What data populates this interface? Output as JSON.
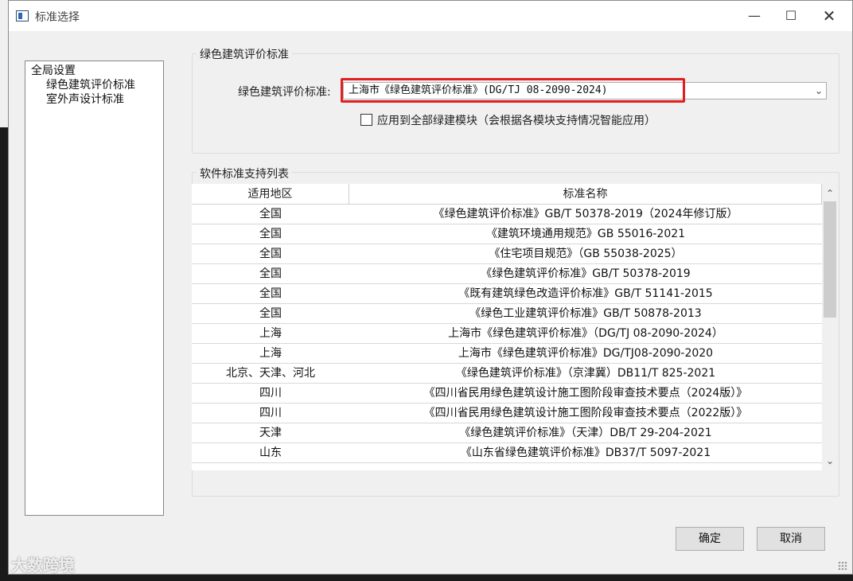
{
  "window": {
    "title": "标准选择",
    "min_glyph": "—",
    "max_glyph": "☐",
    "close_glyph": "✕"
  },
  "tree": {
    "root": "全局设置",
    "children": [
      "绿色建筑评价标准",
      "室外声设计标准"
    ]
  },
  "green_standard": {
    "group_title": "绿色建筑评价标准",
    "label": "绿色建筑评价标准:",
    "selected": "上海市《绿色建筑评价标准》(DG/TJ 08-2090-2024)",
    "checkbox_label": "应用到全部绿建模块（会根据各模块支持情况智能应用）",
    "checkbox_checked": false
  },
  "support_list": {
    "group_title": "软件标准支持列表",
    "headers": [
      "适用地区",
      "标准名称"
    ],
    "rows": [
      [
        "全国",
        "《绿色建筑评价标准》GB/T 50378-2019（2024年修订版）"
      ],
      [
        "全国",
        "《建筑环境通用规范》GB 55016-2021"
      ],
      [
        "全国",
        "《住宅项目规范》（GB 55038-2025）"
      ],
      [
        "全国",
        "《绿色建筑评价标准》GB/T 50378-2019"
      ],
      [
        "全国",
        "《既有建筑绿色改造评价标准》GB/T 51141-2015"
      ],
      [
        "全国",
        "《绿色工业建筑评价标准》GB/T 50878-2013"
      ],
      [
        "上海",
        "上海市《绿色建筑评价标准》（DG/TJ 08-2090-2024）"
      ],
      [
        "上海",
        "上海市《绿色建筑评价标准》DG/TJ08-2090-2020"
      ],
      [
        "北京、天津、河北",
        "《绿色建筑评价标准》（京津冀）DB11/T 825-2021"
      ],
      [
        "四川",
        "《四川省民用绿色建筑设计施工图阶段审查技术要点（2024版）》"
      ],
      [
        "四川",
        "《四川省民用绿色建筑设计施工图阶段审查技术要点（2022版）》"
      ],
      [
        "天津",
        "《绿色建筑评价标准》（天津）DB/T 29-204-2021"
      ],
      [
        "山东",
        "《山东省绿色建筑评价标准》DB37/T 5097-2021"
      ]
    ]
  },
  "buttons": {
    "ok": "确定",
    "cancel": "取消"
  },
  "watermark": "大数跨境",
  "icons": {
    "dropdown": "chevron-down-icon",
    "scroll_up": "chevron-up-icon",
    "scroll_down": "chevron-down-icon"
  },
  "colors": {
    "highlight": "#e02020"
  }
}
